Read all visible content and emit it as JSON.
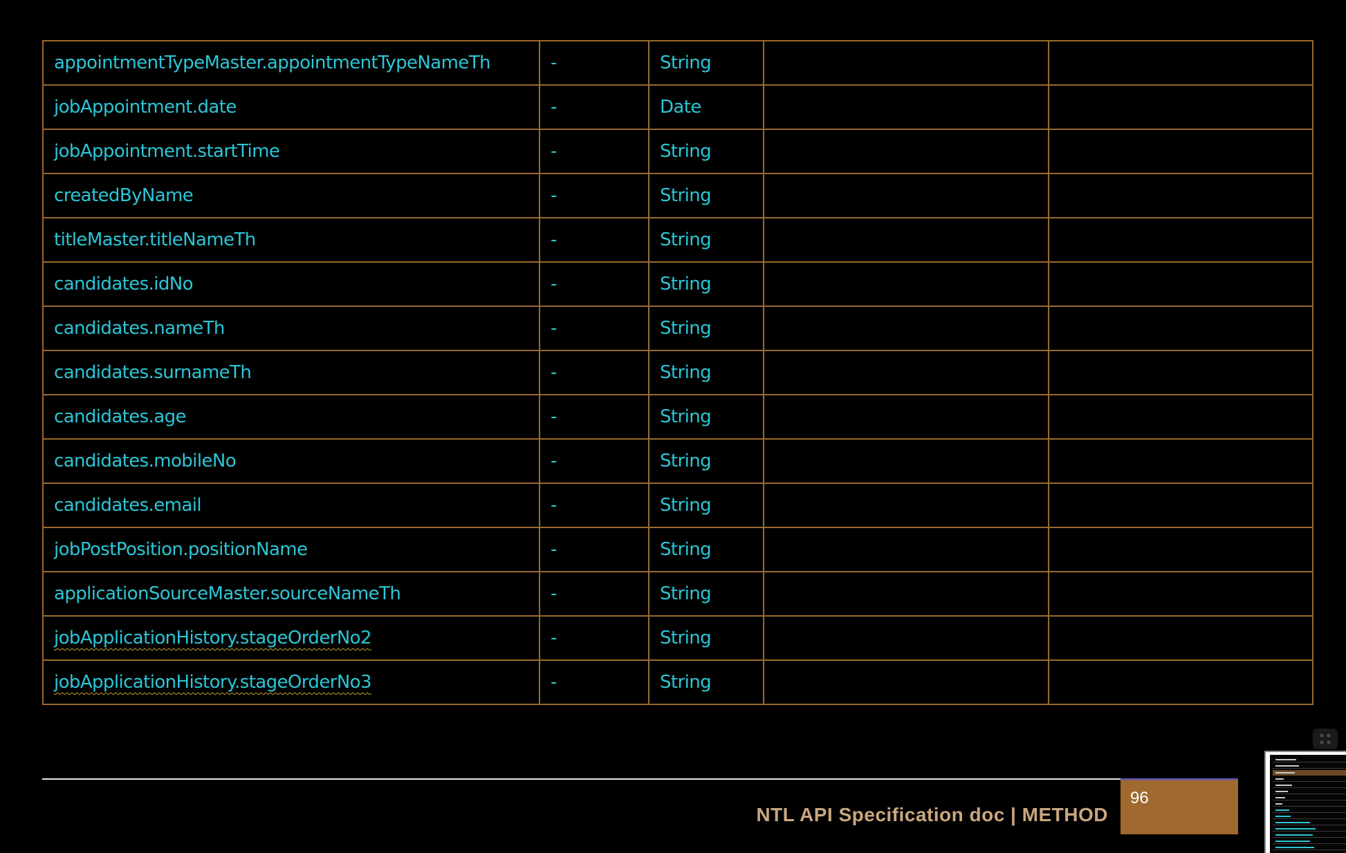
{
  "table": {
    "rows": [
      {
        "field": "appointmentTypeMaster.appointmentTypeNameTh",
        "required": "-",
        "type": "String",
        "description": "",
        "remark": ""
      },
      {
        "field": "jobAppointment.date",
        "required": "-",
        "type": "Date",
        "description": "",
        "remark": ""
      },
      {
        "field": "jobAppointment.startTime",
        "required": "-",
        "type": "String",
        "description": "",
        "remark": ""
      },
      {
        "field": "createdByName",
        "required": "-",
        "type": "String",
        "description": "",
        "remark": ""
      },
      {
        "field": "titleMaster.titleNameTh",
        "required": "-",
        "type": "String",
        "description": "",
        "remark": ""
      },
      {
        "field": "candidates.idNo",
        "required": "-",
        "type": "String",
        "description": "",
        "remark": ""
      },
      {
        "field": "candidates.nameTh",
        "required": "-",
        "type": "String",
        "description": "",
        "remark": ""
      },
      {
        "field": "candidates.surnameTh",
        "required": "-",
        "type": "String",
        "description": "",
        "remark": ""
      },
      {
        "field": "candidates.age",
        "required": "-",
        "type": "String",
        "description": "",
        "remark": ""
      },
      {
        "field": "candidates.mobileNo",
        "required": "-",
        "type": "String",
        "description": "",
        "remark": ""
      },
      {
        "field": "candidates.email",
        "required": "-",
        "type": "String",
        "description": "",
        "remark": ""
      },
      {
        "field": "jobPostPosition.positionName",
        "required": "-",
        "type": "String",
        "description": "",
        "remark": ""
      },
      {
        "field": "applicationSourceMaster.sourceNameTh",
        "required": "-",
        "type": "String",
        "description": "",
        "remark": ""
      },
      {
        "field": "jobApplicationHistory.stageOrderNo2",
        "required": "-",
        "type": "String",
        "description": "",
        "remark": "",
        "spellcheck": true
      },
      {
        "field": "jobApplicationHistory.stageOrderNo3",
        "required": "-",
        "type": "String",
        "description": "",
        "remark": "",
        "spellcheck": true
      }
    ]
  },
  "footer": {
    "title": "NTL API Specification doc | METHOD",
    "page_number": "96"
  },
  "colors": {
    "background": "#000000",
    "cell_text": "#2cc6d6",
    "table_border": "#9a6a2f",
    "footer_text": "#c9a77f",
    "page_box": "#a0692d"
  },
  "icons": {
    "grid_handle": "grid-dots-icon"
  }
}
